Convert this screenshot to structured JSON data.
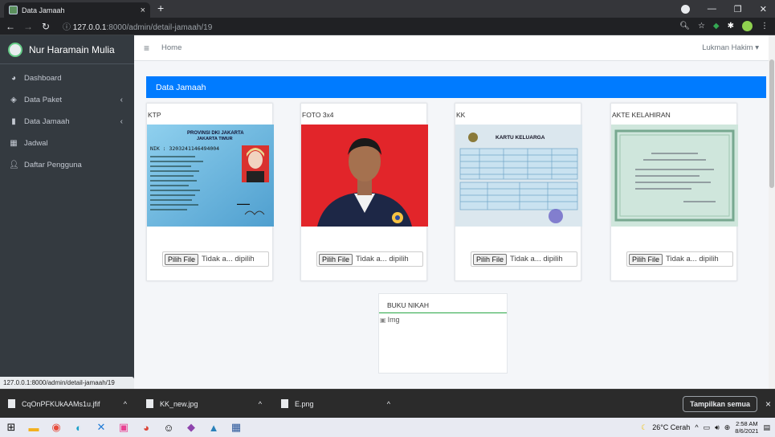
{
  "browser": {
    "tab_title": "Data Jamaah",
    "tab_close": "×",
    "new_tab": "+",
    "url_host": "127.0.0.1",
    "url_port_path": ":8000/admin/detail-jamaah/19"
  },
  "sidebar": {
    "brand": "Nur Haramain Mulia",
    "items": [
      {
        "label": "Dashboard",
        "icon": "dashboard-icon",
        "arrow": ""
      },
      {
        "label": "Data Paket",
        "icon": "box-icon",
        "arrow": "‹"
      },
      {
        "label": "Data Jamaah",
        "icon": "file-icon",
        "arrow": "‹"
      },
      {
        "label": "Jadwal",
        "icon": "calendar-icon",
        "arrow": ""
      },
      {
        "label": "Daftar Pengguna",
        "icon": "user-icon",
        "arrow": ""
      }
    ],
    "status_url": "127.0.0.1:8000/admin/detail-jamaah/19"
  },
  "topnav": {
    "home": "Home",
    "user": "Lukman Hakim ▾"
  },
  "card": {
    "title": "Data Jamaah",
    "docs": [
      {
        "label": "KTP"
      },
      {
        "label": "FOTO 3x4"
      },
      {
        "label": "KK"
      },
      {
        "label": "AKTE KELAHIRAN"
      }
    ],
    "file_button": "Pilih File",
    "file_status": "Tidak a... dipilih",
    "nikah_label": "BUKU NIKAH",
    "nikah_alt": "Img"
  },
  "ktp": {
    "prov": "PROVINSI DKI JAKARTA",
    "city": "JAKARTA TIMUR",
    "nik": "NIK   :  3203241146494004"
  },
  "kk": {
    "title": "KARTU KELUARGA"
  },
  "downloads": {
    "items": [
      {
        "name": "CqOnPFKUkAAMs1u.jfif"
      },
      {
        "name": "KK_new.jpg"
      },
      {
        "name": "E.png"
      }
    ],
    "show_all": "Tampilkan semua",
    "close": "×"
  },
  "taskbar": {
    "weather": "26°C  Cerah",
    "time": "2:58 AM",
    "date": "8/6/2021"
  },
  "colors": {
    "primary": "#007bff",
    "sidebar": "#343a40"
  }
}
